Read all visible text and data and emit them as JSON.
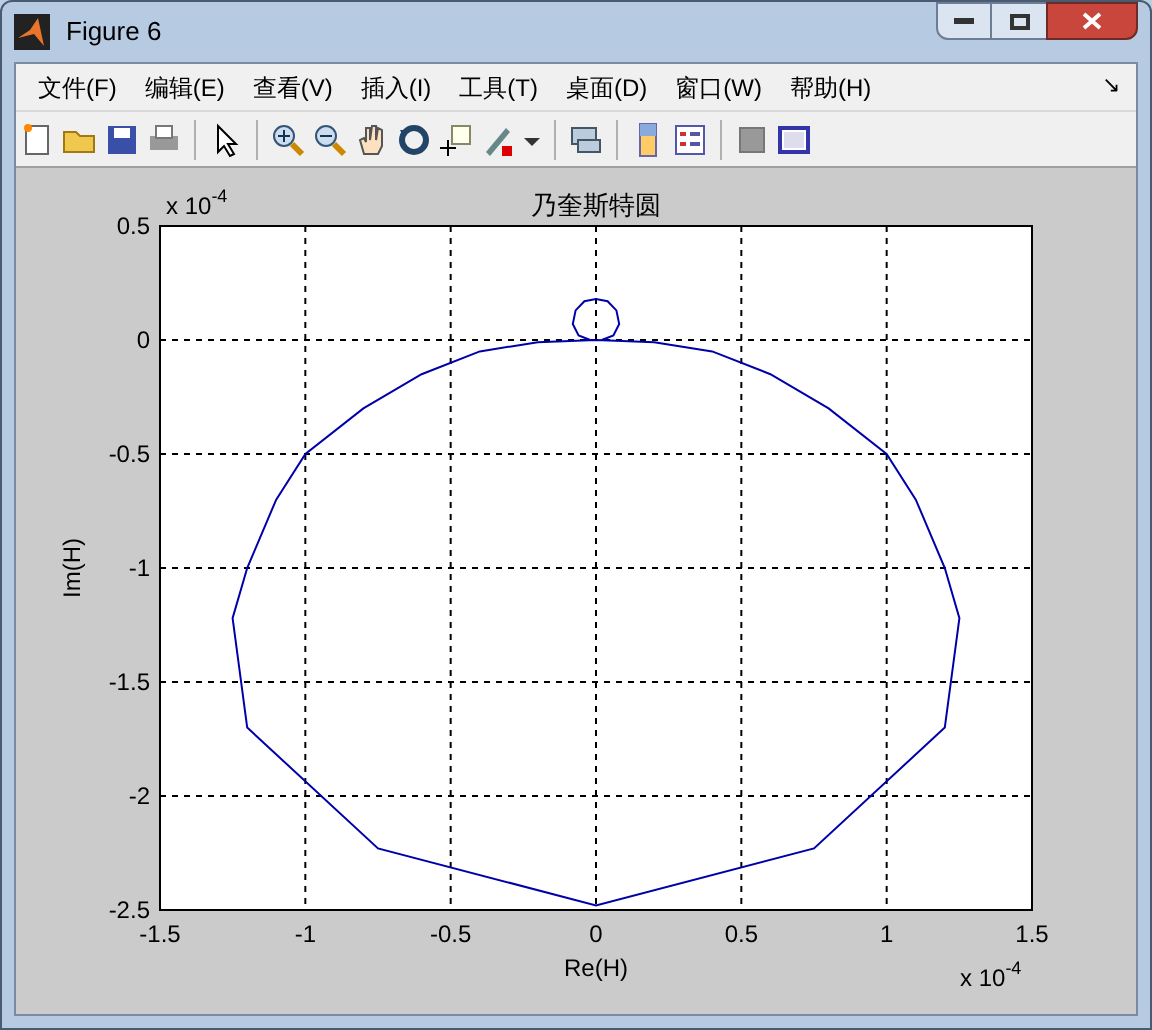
{
  "window": {
    "title": "Figure 6"
  },
  "menu": [
    "文件(F)",
    "编辑(E)",
    "查看(V)",
    "插入(I)",
    "工具(T)",
    "桌面(D)",
    "窗口(W)",
    "帮助(H)"
  ],
  "menu_arrow": "↘",
  "toolbar": [
    {
      "kind": "new"
    },
    {
      "kind": "open"
    },
    {
      "kind": "save"
    },
    {
      "kind": "print"
    },
    {
      "kind": "sep"
    },
    {
      "kind": "pointer"
    },
    {
      "kind": "sep"
    },
    {
      "kind": "zoom-in"
    },
    {
      "kind": "zoom-out"
    },
    {
      "kind": "pan"
    },
    {
      "kind": "rotate"
    },
    {
      "kind": "datacursor"
    },
    {
      "kind": "brush"
    },
    {
      "kind": "caret"
    },
    {
      "kind": "sep"
    },
    {
      "kind": "link"
    },
    {
      "kind": "sep"
    },
    {
      "kind": "colorbar"
    },
    {
      "kind": "legend"
    },
    {
      "kind": "sep"
    },
    {
      "kind": "hide"
    },
    {
      "kind": "show"
    }
  ],
  "axes": {
    "x_multiplier": "x 10",
    "x_exponent": "-4",
    "y_multiplier": "x 10",
    "y_exponent": "-4",
    "chart_data": {
      "type": "line",
      "grid": true,
      "title": "乃奎斯特圆",
      "xlabel": "Re(H)",
      "ylabel": "Im(H)",
      "xlim": [
        -1.5,
        1.5
      ],
      "ylim": [
        -2.5,
        0.5
      ],
      "xticks": [
        -1.5,
        -1,
        -0.5,
        0,
        0.5,
        1,
        1.5
      ],
      "yticks": [
        -2.5,
        -2,
        -1.5,
        -1,
        -0.5,
        0,
        0.5
      ],
      "x": [
        0.02,
        0.06,
        0.08,
        0.07,
        0.04,
        0,
        -0.04,
        -0.07,
        -0.08,
        -0.06,
        -0.02,
        0,
        -0.2,
        -0.4,
        -0.6,
        -0.8,
        -1.0,
        -1.1,
        -1.2,
        -1.25,
        -1.2,
        -0.75,
        0,
        0.75,
        1.2,
        1.25,
        1.2,
        1.1,
        1.0,
        0.8,
        0.6,
        0.4,
        0.2,
        0
      ],
      "series": [
        {
          "color": "#0000aa",
          "values": [
            0,
            0.02,
            0.07,
            0.13,
            0.17,
            0.18,
            0.17,
            0.13,
            0.07,
            0.02,
            0,
            0,
            -0.01,
            -0.05,
            -0.15,
            -0.3,
            -0.5,
            -0.7,
            -1.0,
            -1.22,
            -1.7,
            -2.23,
            -2.48,
            -2.23,
            -1.7,
            -1.22,
            -1.0,
            -0.7,
            -0.5,
            -0.3,
            -0.15,
            -0.05,
            -0.01,
            0
          ]
        }
      ]
    }
  }
}
